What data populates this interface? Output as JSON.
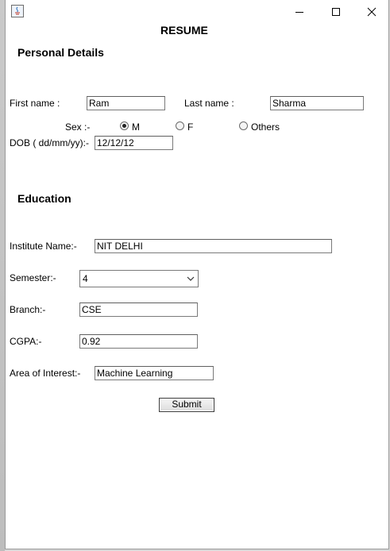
{
  "window": {
    "title": "RESUME"
  },
  "personal": {
    "heading": "Personal Details",
    "first_name_label": "First name :",
    "first_name_value": "Ram",
    "last_name_label": "Last name :",
    "last_name_value": "Sharma",
    "sex_label": "Sex :-",
    "sex_options": [
      "M",
      "F",
      "Others"
    ],
    "sex_selected": "M",
    "dob_label": "DOB ( dd/mm/yy):-",
    "dob_value": "12/12/12"
  },
  "education": {
    "heading": "Education",
    "institute_label": "Institute Name:-",
    "institute_value": "NIT DELHI",
    "semester_label": "Semester:-",
    "semester_value": "4",
    "branch_label": "Branch:-",
    "branch_value": "CSE",
    "cgpa_label": "CGPA:-",
    "cgpa_value": "0.92",
    "interest_label": "Area of Interest:-",
    "interest_value": "Machine Learning"
  },
  "actions": {
    "submit_label": "Submit"
  },
  "icons": {
    "app": "java-icon",
    "minimize": "minimize-icon",
    "maximize": "maximize-icon",
    "close": "close-icon",
    "dropdown": "chevron-down-icon"
  }
}
